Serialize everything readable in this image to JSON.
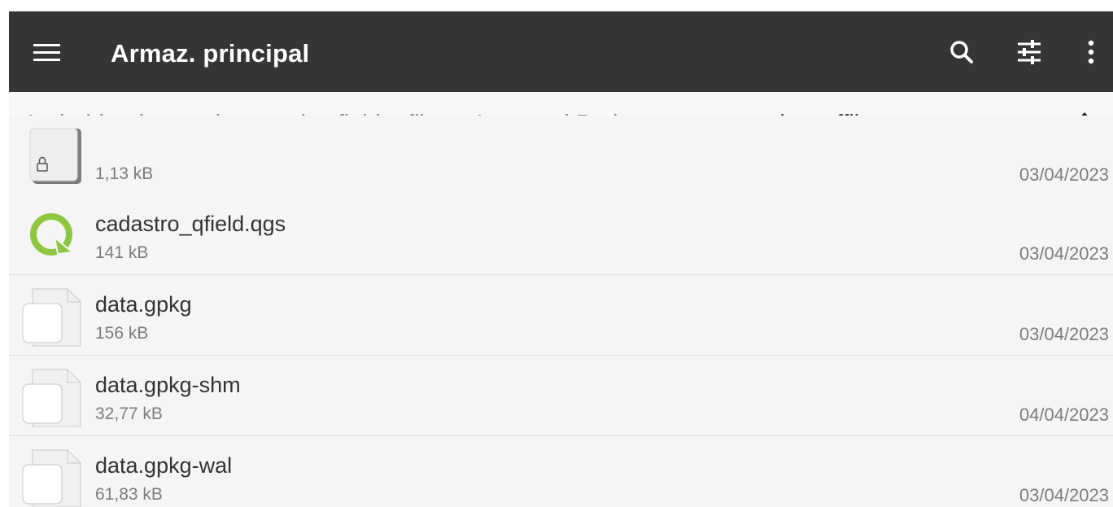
{
  "toolbar": {
    "title": "Armaz. principal",
    "icons": [
      "menu-icon",
      "search-icon",
      "tune-icon",
      "more-vert-icon"
    ]
  },
  "breadcrumb": {
    "items": [
      "Android",
      "data",
      "ch.opengis.qfield",
      "files",
      "Imported Projects"
    ],
    "current": "ocorrencias_offline_ns",
    "separator": ">"
  },
  "files": [
    {
      "name": "",
      "size": "1,13 kB",
      "date": "03/04/2023",
      "icon": "archive-lock-icon"
    },
    {
      "name": "cadastro_qfield.qgs",
      "size": "141 kB",
      "date": "03/04/2023",
      "icon": "qfield-icon"
    },
    {
      "name": "data.gpkg",
      "size": "156 kB",
      "date": "03/04/2023",
      "icon": "file-icon"
    },
    {
      "name": "data.gpkg-shm",
      "size": "32,77 kB",
      "date": "04/04/2023",
      "icon": "file-icon"
    },
    {
      "name": "data.gpkg-wal",
      "size": "61,83 kB",
      "date": "03/04/2023",
      "icon": "file-icon"
    }
  ],
  "colors": {
    "toolbar": "#353535",
    "qfield_green": "#8dc63f",
    "background": "#f5f5f5"
  }
}
